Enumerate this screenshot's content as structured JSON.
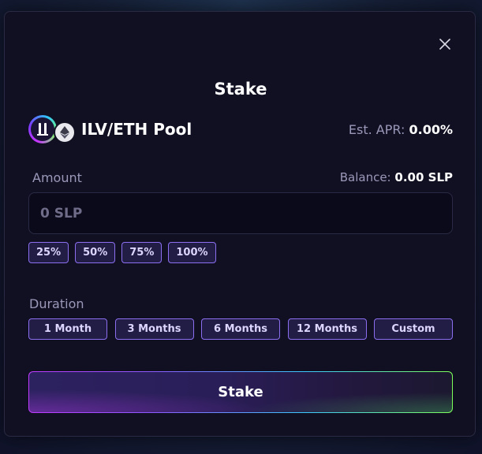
{
  "modal": {
    "title": "Stake",
    "close_icon": "close-icon"
  },
  "pool": {
    "name": "ILV/ETH Pool",
    "icons": [
      "ilv-token-icon",
      "eth-token-icon"
    ],
    "apr_label": "Est. APR:",
    "apr_value": "0.00%"
  },
  "amount": {
    "label": "Amount",
    "balance_label": "Balance:",
    "balance_value": "0.00 SLP",
    "placeholder": "0 SLP",
    "value": "",
    "presets": [
      "25%",
      "50%",
      "75%",
      "100%"
    ]
  },
  "duration": {
    "label": "Duration",
    "options": [
      "1 Month",
      "3 Months",
      "6 Months",
      "12 Months",
      "Custom"
    ]
  },
  "action": {
    "stake_label": "Stake"
  },
  "colors": {
    "accent": "#8c6ff0",
    "background": "#111023",
    "gradient_start": "#c03aff",
    "gradient_end": "#7dff5a"
  }
}
